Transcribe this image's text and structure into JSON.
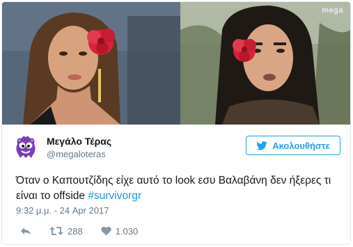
{
  "media": {
    "right_channel_logo": "mega"
  },
  "author": {
    "display_name": "Μεγάλο Τέρας",
    "handle": "@megaloteras"
  },
  "follow_button": {
    "label": "Ακολουθήστε"
  },
  "tweet": {
    "text_main": "Όταν ο Καπουτζίδης είχε αυτό το look εσυ Βαλαβάνη δεν ήξερες τι είναι το offside ",
    "hashtag": "#survivorgr",
    "timestamp": "9:32 μ.μ. - 24 Apr 2017"
  },
  "stats": {
    "retweets": "288",
    "likes": "1.030"
  },
  "icons": {
    "reply": "reply-icon",
    "retweet": "retweet-icon",
    "like": "heart-icon",
    "twitter_bird": "twitter-bird-icon",
    "avatar": "purple-monster-avatar"
  },
  "colors": {
    "accent": "#1da1f2",
    "hashtag": "#1b95e0",
    "secondary_text": "#657786",
    "avatar_purple": "#7b3fb5"
  }
}
